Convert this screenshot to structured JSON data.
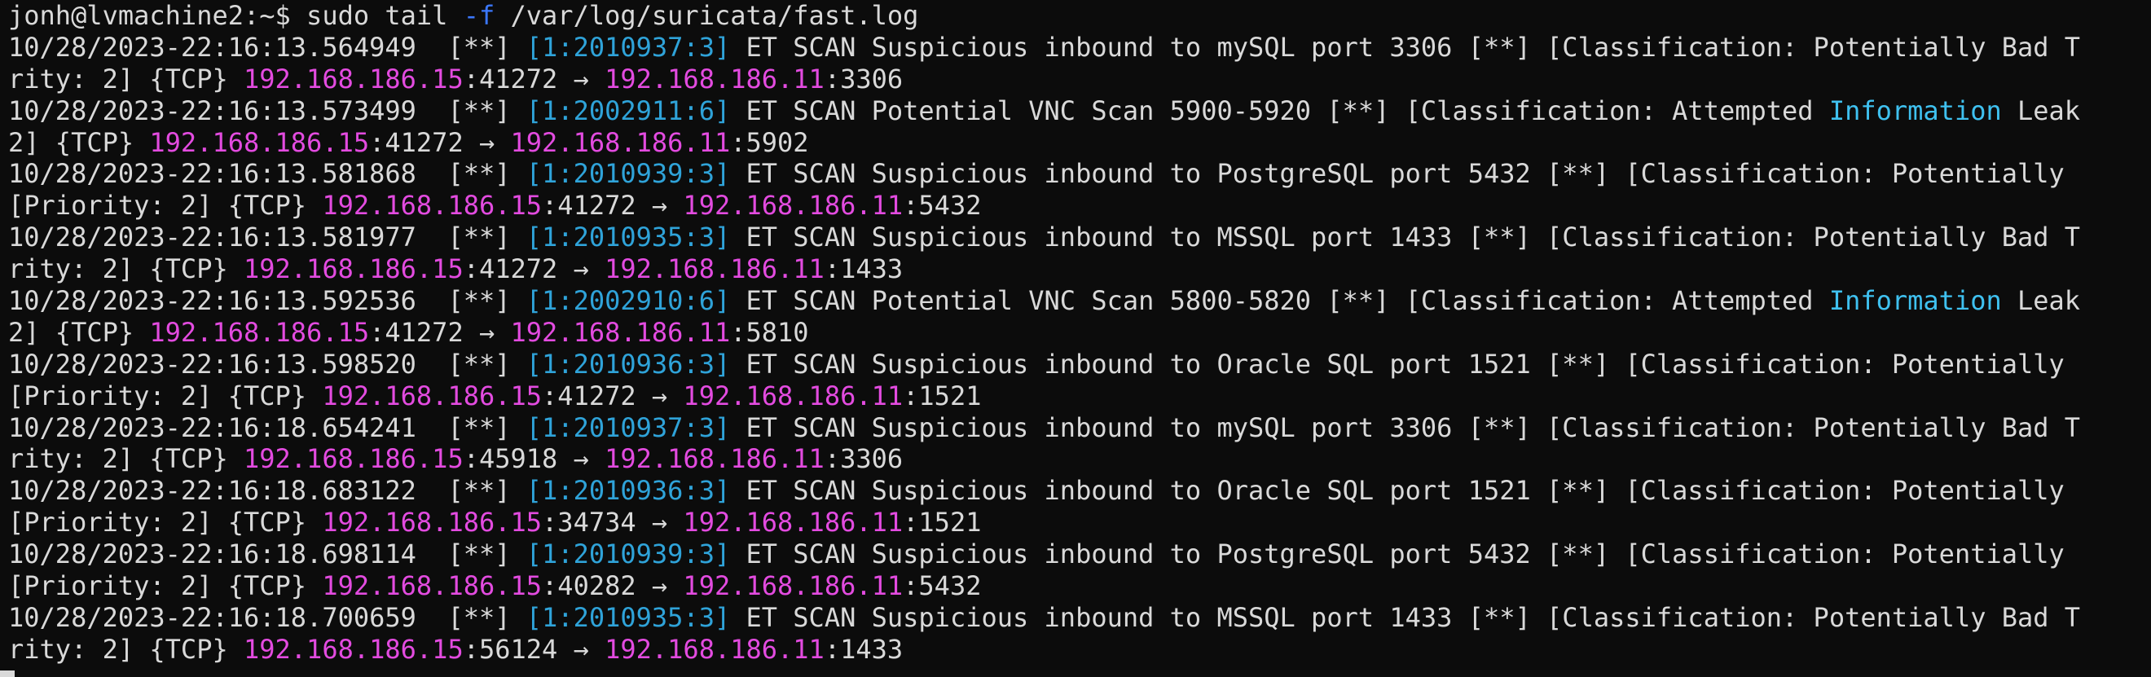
{
  "prompt": {
    "user_host": "jonh@lvmachine2:~$",
    "cmd_pre": " sudo tail ",
    "flag": "-f",
    "cmd_post": " /var/log/suricata/fast.log"
  },
  "lines": [
    {
      "segs": [
        {
          "t": "10/28/2023-22:16:13.564949  [**] ",
          "c": ""
        },
        {
          "t": "[1:2010937:3]",
          "c": "sid"
        },
        {
          "t": " ET SCAN Suspicious inbound to mySQL port 3306 [**] [Classification: Potentially Bad T",
          "c": ""
        }
      ]
    },
    {
      "segs": [
        {
          "t": "rity: 2] {TCP} ",
          "c": ""
        },
        {
          "t": "192.168.186.15",
          "c": "src"
        },
        {
          "t": ":41272 → ",
          "c": ""
        },
        {
          "t": "192.168.186.11",
          "c": "dst"
        },
        {
          "t": ":3306",
          "c": ""
        }
      ]
    },
    {
      "segs": [
        {
          "t": "10/28/2023-22:16:13.573499  [**] ",
          "c": ""
        },
        {
          "t": "[1:2002911:6]",
          "c": "sid"
        },
        {
          "t": " ET SCAN Potential VNC Scan 5900-5920 [**] [Classification: Attempted ",
          "c": ""
        },
        {
          "t": "Information",
          "c": "info"
        },
        {
          "t": " Leak",
          "c": ""
        }
      ]
    },
    {
      "segs": [
        {
          "t": "2] {TCP} ",
          "c": ""
        },
        {
          "t": "192.168.186.15",
          "c": "src"
        },
        {
          "t": ":41272 → ",
          "c": ""
        },
        {
          "t": "192.168.186.11",
          "c": "dst"
        },
        {
          "t": ":5902",
          "c": ""
        }
      ]
    },
    {
      "segs": [
        {
          "t": "10/28/2023-22:16:13.581868  [**] ",
          "c": ""
        },
        {
          "t": "[1:2010939:3]",
          "c": "sid"
        },
        {
          "t": " ET SCAN Suspicious inbound to PostgreSQL port 5432 [**] [Classification: Potentially",
          "c": ""
        }
      ]
    },
    {
      "segs": [
        {
          "t": "[Priority: 2] {TCP} ",
          "c": ""
        },
        {
          "t": "192.168.186.15",
          "c": "src"
        },
        {
          "t": ":41272 → ",
          "c": ""
        },
        {
          "t": "192.168.186.11",
          "c": "dst"
        },
        {
          "t": ":5432",
          "c": ""
        }
      ]
    },
    {
      "segs": [
        {
          "t": "10/28/2023-22:16:13.581977  [**] ",
          "c": ""
        },
        {
          "t": "[1:2010935:3]",
          "c": "sid"
        },
        {
          "t": " ET SCAN Suspicious inbound to MSSQL port 1433 [**] [Classification: Potentially Bad T",
          "c": ""
        }
      ]
    },
    {
      "segs": [
        {
          "t": "rity: 2] {TCP} ",
          "c": ""
        },
        {
          "t": "192.168.186.15",
          "c": "src"
        },
        {
          "t": ":41272 → ",
          "c": ""
        },
        {
          "t": "192.168.186.11",
          "c": "dst"
        },
        {
          "t": ":1433",
          "c": ""
        }
      ]
    },
    {
      "segs": [
        {
          "t": "10/28/2023-22:16:13.592536  [**] ",
          "c": ""
        },
        {
          "t": "[1:2002910:6]",
          "c": "sid"
        },
        {
          "t": " ET SCAN Potential VNC Scan 5800-5820 [**] [Classification: Attempted ",
          "c": ""
        },
        {
          "t": "Information",
          "c": "info"
        },
        {
          "t": " Leak",
          "c": ""
        }
      ]
    },
    {
      "segs": [
        {
          "t": "2] {TCP} ",
          "c": ""
        },
        {
          "t": "192.168.186.15",
          "c": "src"
        },
        {
          "t": ":41272 → ",
          "c": ""
        },
        {
          "t": "192.168.186.11",
          "c": "dst"
        },
        {
          "t": ":5810",
          "c": ""
        }
      ]
    },
    {
      "segs": [
        {
          "t": "10/28/2023-22:16:13.598520  [**] ",
          "c": ""
        },
        {
          "t": "[1:2010936:3]",
          "c": "sid"
        },
        {
          "t": " ET SCAN Suspicious inbound to Oracle SQL port 1521 [**] [Classification: Potentially",
          "c": ""
        }
      ]
    },
    {
      "segs": [
        {
          "t": "[Priority: 2] {TCP} ",
          "c": ""
        },
        {
          "t": "192.168.186.15",
          "c": "src"
        },
        {
          "t": ":41272 → ",
          "c": ""
        },
        {
          "t": "192.168.186.11",
          "c": "dst"
        },
        {
          "t": ":1521",
          "c": ""
        }
      ]
    },
    {
      "segs": [
        {
          "t": "10/28/2023-22:16:18.654241  [**] ",
          "c": ""
        },
        {
          "t": "[1:2010937:3]",
          "c": "sid"
        },
        {
          "t": " ET SCAN Suspicious inbound to mySQL port 3306 [**] [Classification: Potentially Bad T",
          "c": ""
        }
      ]
    },
    {
      "segs": [
        {
          "t": "rity: 2] {TCP} ",
          "c": ""
        },
        {
          "t": "192.168.186.15",
          "c": "src"
        },
        {
          "t": ":45918 → ",
          "c": ""
        },
        {
          "t": "192.168.186.11",
          "c": "dst"
        },
        {
          "t": ":3306",
          "c": ""
        }
      ]
    },
    {
      "segs": [
        {
          "t": "10/28/2023-22:16:18.683122  [**] ",
          "c": ""
        },
        {
          "t": "[1:2010936:3]",
          "c": "sid"
        },
        {
          "t": " ET SCAN Suspicious inbound to Oracle SQL port 1521 [**] [Classification: Potentially",
          "c": ""
        }
      ]
    },
    {
      "segs": [
        {
          "t": "[Priority: 2] {TCP} ",
          "c": ""
        },
        {
          "t": "192.168.186.15",
          "c": "src"
        },
        {
          "t": ":34734 → ",
          "c": ""
        },
        {
          "t": "192.168.186.11",
          "c": "dst"
        },
        {
          "t": ":1521",
          "c": ""
        }
      ]
    },
    {
      "segs": [
        {
          "t": "10/28/2023-22:16:18.698114  [**] ",
          "c": ""
        },
        {
          "t": "[1:2010939:3]",
          "c": "sid"
        },
        {
          "t": " ET SCAN Suspicious inbound to PostgreSQL port 5432 [**] [Classification: Potentially",
          "c": ""
        }
      ]
    },
    {
      "segs": [
        {
          "t": "[Priority: 2] {TCP} ",
          "c": ""
        },
        {
          "t": "192.168.186.15",
          "c": "src"
        },
        {
          "t": ":40282 → ",
          "c": ""
        },
        {
          "t": "192.168.186.11",
          "c": "dst"
        },
        {
          "t": ":5432",
          "c": ""
        }
      ]
    },
    {
      "segs": [
        {
          "t": "10/28/2023-22:16:18.700659  [**] ",
          "c": ""
        },
        {
          "t": "[1:2010935:3]",
          "c": "sid"
        },
        {
          "t": " ET SCAN Suspicious inbound to MSSQL port 1433 [**] [Classification: Potentially Bad T",
          "c": ""
        }
      ]
    },
    {
      "segs": [
        {
          "t": "rity: 2] {TCP} ",
          "c": ""
        },
        {
          "t": "192.168.186.15",
          "c": "src"
        },
        {
          "t": ":56124 → ",
          "c": ""
        },
        {
          "t": "192.168.186.11",
          "c": "dst"
        },
        {
          "t": ":1433",
          "c": ""
        }
      ]
    }
  ]
}
